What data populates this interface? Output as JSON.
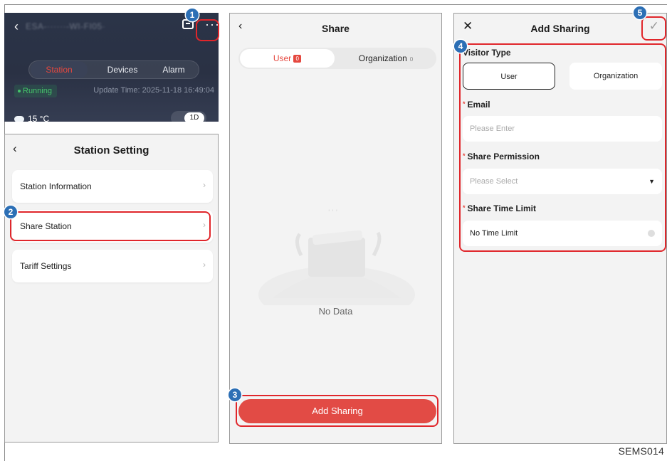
{
  "caption": "SEMS014",
  "station_header": {
    "title_blurred": "ESA-······-WI-FI05·",
    "tabs": [
      "Station",
      "Devices",
      "Alarm"
    ],
    "status": "Running",
    "update_time": "Update Time: 2025-11-18 16:49:04",
    "temperature": "15 °C",
    "period": "1D"
  },
  "station_setting": {
    "title": "Station Setting",
    "items": [
      {
        "label": "Station Information"
      },
      {
        "label": "Share Station"
      },
      {
        "label": "Tariff Settings"
      }
    ]
  },
  "share": {
    "title": "Share",
    "tabs": [
      {
        "label": "User",
        "count": "0"
      },
      {
        "label": "Organization",
        "count": "0"
      }
    ],
    "empty_text": "No Data",
    "add_button": "Add Sharing"
  },
  "add_sharing": {
    "title": "Add Sharing",
    "visitor_type_label": "Visitor Type",
    "visitor_types": [
      "User",
      "Organization"
    ],
    "email_label": "Email",
    "email_placeholder": "Please Enter",
    "permission_label": "Share Permission",
    "permission_placeholder": "Please Select",
    "time_limit_label": "Share Time Limit",
    "time_limit_value": "No Time Limit"
  },
  "steps": [
    "1",
    "2",
    "3",
    "4",
    "5"
  ],
  "colors": {
    "accent_red": "#e24b45",
    "highlight": "#e0262b",
    "step_badge": "#2c6fb5",
    "running_green": "#45c46b"
  },
  "icons": [
    "back-arrow-icon",
    "chat-icon",
    "more-icon",
    "cloud-icon",
    "chevron-right-icon",
    "close-icon",
    "check-icon",
    "caret-down-icon",
    "clear-icon"
  ]
}
